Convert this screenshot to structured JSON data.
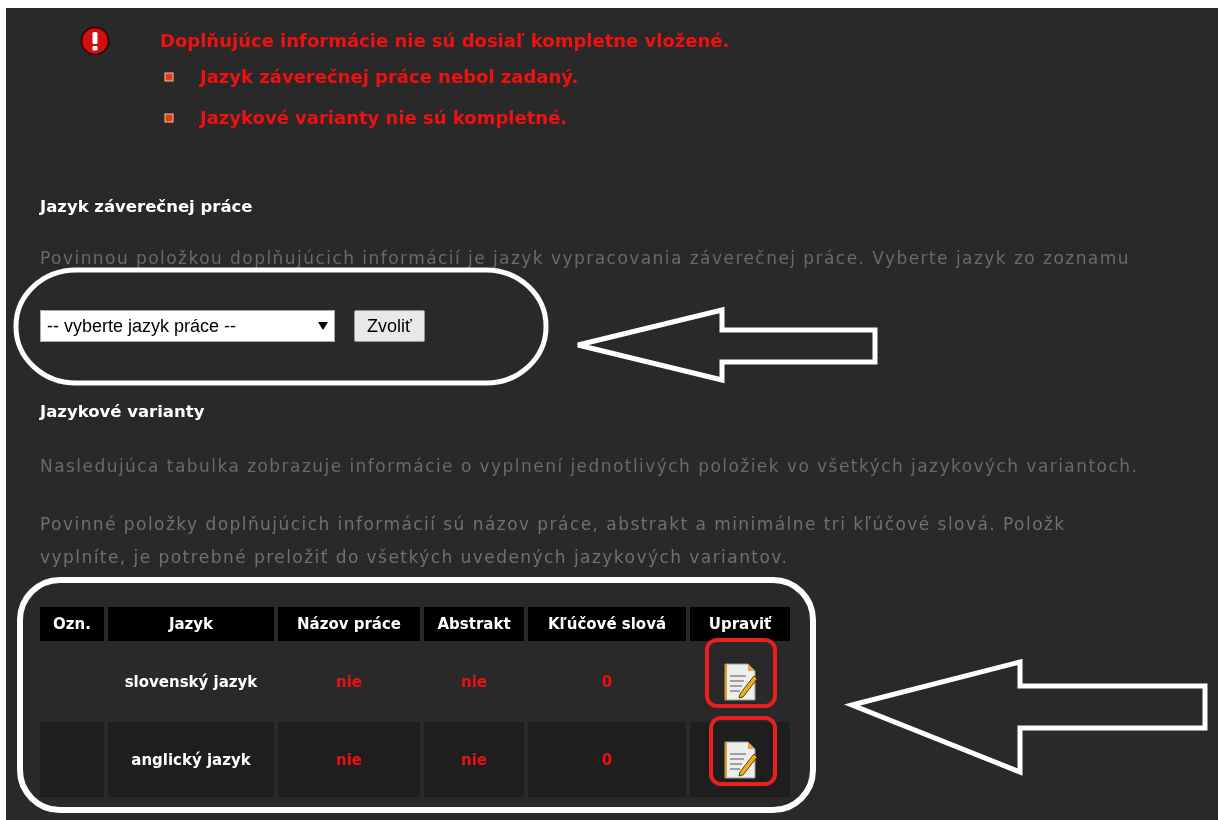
{
  "alert": {
    "title": "Doplňujúce informácie nie sú dosiaľ kompletne vložené.",
    "items": [
      "Jazyk záverečnej práce nebol zadaný.",
      "Jazykové varianty nie sú kompletné."
    ]
  },
  "language_section": {
    "heading": "Jazyk záverečnej práce",
    "text": "Povinnou položkou doplňujúcich informácií je jazyk vypracovania záverečnej práce. Vyberte jazyk zo zoznamu",
    "select": {
      "value": "-- vyberte jazyk práce --"
    },
    "button": "Zvoliť"
  },
  "variants_section": {
    "heading": "Jazykové varianty",
    "paragraphs": [
      {
        "lines": [
          "Nasledujúca tabulka zobrazuje informácie o vyplnení jednotlivých položiek vo všetkých jazykových variantoch."
        ]
      },
      {
        "lines": [
          "Povinné položky doplňujúcich informácií sú názov práce, abstrakt a minimálne tri kľúčové slová. Položk",
          "vyplníte, je potrebné preložiť do všetkých uvedených jazykových variantov."
        ]
      }
    ]
  },
  "table": {
    "columns": [
      "Ozn.",
      "Jazyk",
      "Názov práce",
      "Abstrakt",
      "Kľúčové slová",
      "Upraviť"
    ],
    "rows": [
      {
        "language": "slovenský jazyk",
        "title": "nie",
        "abstract": "nie",
        "keywords": "0"
      },
      {
        "language": "anglický jazyk",
        "title": "nie",
        "abstract": "nie",
        "keywords": "0"
      }
    ]
  }
}
